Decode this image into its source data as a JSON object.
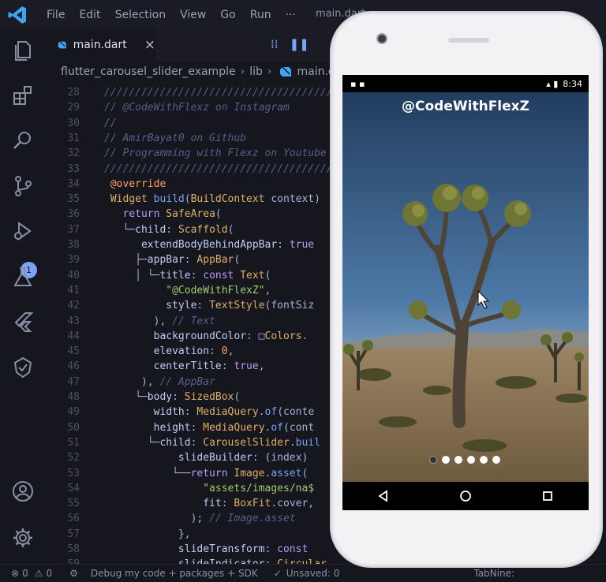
{
  "menu": [
    "File",
    "Edit",
    "Selection",
    "View",
    "Go",
    "Run",
    "···"
  ],
  "window_title": "main.dart",
  "tab": {
    "label": "main.dart",
    "close": "×"
  },
  "breadcrumb": [
    "flutter_carousel_slider_example",
    "lib",
    "main.dart"
  ],
  "activity_badge": "1",
  "code_lines": [
    {
      "n": "28",
      "t": [
        [
          "comment",
          "/////////////////////////////////////"
        ]
      ]
    },
    {
      "n": "29",
      "t": [
        [
          "comment",
          "// @CodeWithFlexz on Instagram"
        ]
      ]
    },
    {
      "n": "30",
      "t": [
        [
          "comment",
          "//"
        ]
      ]
    },
    {
      "n": "31",
      "t": [
        [
          "comment",
          "// AmirBayat0 on Github"
        ]
      ]
    },
    {
      "n": "32",
      "t": [
        [
          "comment",
          "// Programming with Flexz on Youtube"
        ]
      ]
    },
    {
      "n": "33",
      "t": [
        [
          "comment",
          "/////////////////////////////////////"
        ]
      ]
    },
    {
      "n": "34",
      "t": [
        [
          "anno",
          " @override"
        ]
      ]
    },
    {
      "n": "35",
      "t": [
        [
          "type",
          " Widget "
        ],
        [
          "func",
          "build"
        ],
        [
          "plain",
          "("
        ],
        [
          "type",
          "BuildContext"
        ],
        [
          "plain",
          " context)"
        ]
      ]
    },
    {
      "n": "36",
      "t": [
        [
          "kw",
          "   return "
        ],
        [
          "type",
          "SafeArea"
        ],
        [
          "plain",
          "("
        ]
      ]
    },
    {
      "n": "37",
      "t": [
        [
          "plain",
          "   └─"
        ],
        [
          "prop",
          "child"
        ],
        [
          "plain",
          ": "
        ],
        [
          "type",
          "Scaffold"
        ],
        [
          "plain",
          "("
        ]
      ]
    },
    {
      "n": "38",
      "t": [
        [
          "plain",
          "      "
        ],
        [
          "prop",
          "extendBodyBehindAppBar"
        ],
        [
          "plain",
          ": "
        ],
        [
          "kw",
          "true"
        ]
      ]
    },
    {
      "n": "39",
      "t": [
        [
          "plain",
          "     ├─"
        ],
        [
          "prop",
          "appBar"
        ],
        [
          "plain",
          ": "
        ],
        [
          "type",
          "AppBar"
        ],
        [
          "plain",
          "("
        ]
      ]
    },
    {
      "n": "40",
      "t": [
        [
          "plain",
          "     │ └─"
        ],
        [
          "prop",
          "title"
        ],
        [
          "plain",
          ": "
        ],
        [
          "kw",
          "const "
        ],
        [
          "type",
          "Text"
        ],
        [
          "plain",
          "("
        ]
      ]
    },
    {
      "n": "41",
      "t": [
        [
          "plain",
          "          "
        ],
        [
          "str",
          "\"@CodeWithFlexZ\""
        ],
        [
          "plain",
          ","
        ]
      ]
    },
    {
      "n": "42",
      "t": [
        [
          "plain",
          "          "
        ],
        [
          "prop",
          "style"
        ],
        [
          "plain",
          ": "
        ],
        [
          "type",
          "TextStyle"
        ],
        [
          "plain",
          "(fontSiz"
        ]
      ]
    },
    {
      "n": "43",
      "t": [
        [
          "plain",
          "        ), "
        ],
        [
          "comment",
          "// Text"
        ]
      ]
    },
    {
      "n": "44",
      "t": [
        [
          "plain",
          "        "
        ],
        [
          "prop",
          "backgroundColor"
        ],
        [
          "plain",
          ": □"
        ],
        [
          "type",
          "Colors"
        ],
        [
          "plain",
          "."
        ]
      ]
    },
    {
      "n": "45",
      "t": [
        [
          "plain",
          "        "
        ],
        [
          "prop",
          "elevation"
        ],
        [
          "plain",
          ": "
        ],
        [
          "num",
          "0"
        ],
        [
          "plain",
          ","
        ]
      ]
    },
    {
      "n": "46",
      "t": [
        [
          "plain",
          "        "
        ],
        [
          "prop",
          "centerTitle"
        ],
        [
          "plain",
          ": "
        ],
        [
          "kw",
          "true"
        ],
        [
          "plain",
          ","
        ]
      ]
    },
    {
      "n": "47",
      "t": [
        [
          "plain",
          "      ), "
        ],
        [
          "comment",
          "// AppBar"
        ]
      ]
    },
    {
      "n": "48",
      "t": [
        [
          "plain",
          "     └─"
        ],
        [
          "prop",
          "body"
        ],
        [
          "plain",
          ": "
        ],
        [
          "type",
          "SizedBox"
        ],
        [
          "plain",
          "("
        ]
      ]
    },
    {
      "n": "49",
      "t": [
        [
          "plain",
          "        "
        ],
        [
          "prop",
          "width"
        ],
        [
          "plain",
          ": "
        ],
        [
          "type",
          "MediaQuery"
        ],
        [
          "plain",
          "."
        ],
        [
          "func",
          "of"
        ],
        [
          "plain",
          "(conte"
        ]
      ]
    },
    {
      "n": "50",
      "t": [
        [
          "plain",
          "        "
        ],
        [
          "prop",
          "height"
        ],
        [
          "plain",
          ": "
        ],
        [
          "type",
          "MediaQuery"
        ],
        [
          "plain",
          "."
        ],
        [
          "func",
          "of"
        ],
        [
          "plain",
          "(cont"
        ]
      ]
    },
    {
      "n": "51",
      "t": [
        [
          "plain",
          "       └─"
        ],
        [
          "prop",
          "child"
        ],
        [
          "plain",
          ": "
        ],
        [
          "type",
          "CarouselSlider"
        ],
        [
          "plain",
          "."
        ],
        [
          "func",
          "buil"
        ]
      ]
    },
    {
      "n": "52",
      "t": [
        [
          "plain",
          "            "
        ],
        [
          "prop",
          "slideBuilder"
        ],
        [
          "plain",
          ": (index)"
        ]
      ]
    },
    {
      "n": "53",
      "t": [
        [
          "plain",
          "           └──"
        ],
        [
          "kw",
          "return "
        ],
        [
          "type",
          "Image"
        ],
        [
          "plain",
          "."
        ],
        [
          "func",
          "asset"
        ],
        [
          "plain",
          "("
        ]
      ]
    },
    {
      "n": "54",
      "t": [
        [
          "plain",
          "                "
        ],
        [
          "str",
          "\"assets/images/na$"
        ]
      ]
    },
    {
      "n": "55",
      "t": [
        [
          "plain",
          "                "
        ],
        [
          "prop",
          "fit"
        ],
        [
          "plain",
          ": "
        ],
        [
          "type",
          "BoxFit"
        ],
        [
          "plain",
          ".cover,"
        ]
      ]
    },
    {
      "n": "56",
      "t": [
        [
          "plain",
          "              ); "
        ],
        [
          "comment",
          "// Image.asset"
        ]
      ]
    },
    {
      "n": "57",
      "t": [
        [
          "plain",
          "            },"
        ]
      ]
    },
    {
      "n": "58",
      "t": [
        [
          "plain",
          "            "
        ],
        [
          "prop",
          "slideTransform"
        ],
        [
          "plain",
          ": "
        ],
        [
          "kw",
          "const"
        ]
      ]
    },
    {
      "n": "59",
      "t": [
        [
          "plain",
          "            "
        ],
        [
          "prop",
          "slideIndicator"
        ],
        [
          "plain",
          ": "
        ],
        [
          "type",
          "Circular"
        ]
      ]
    }
  ],
  "status": {
    "errors": "0",
    "warnings": "0",
    "debug": "Debug my code + packages + SDK",
    "unsaved": "Unsaved: 0",
    "right": "TabNine:"
  },
  "phone": {
    "time": "8:34",
    "appbar_title": "@CodeWithFlexZ",
    "dots_total": 6,
    "dot_active": 0
  },
  "colors": {
    "accent": "#7aa2f7",
    "background": "#16161e"
  }
}
